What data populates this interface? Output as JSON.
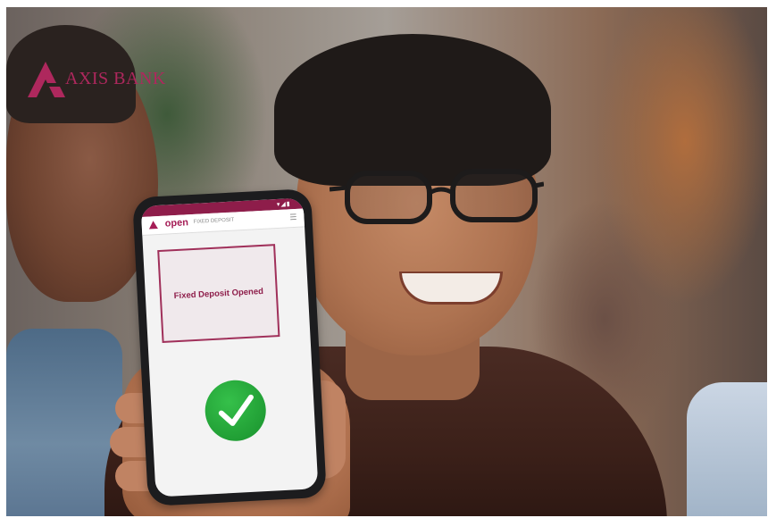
{
  "brand": {
    "name": "AXIS BANK",
    "color": "#ae285d"
  },
  "phone": {
    "app": {
      "name": "open",
      "subtitle": "FIXED DEPOSIT"
    },
    "message": "Fixed Deposit Opened",
    "status_icon": "check-circle-icon",
    "accent_color": "#8e1d4a",
    "success_color": "#1e9a32"
  }
}
